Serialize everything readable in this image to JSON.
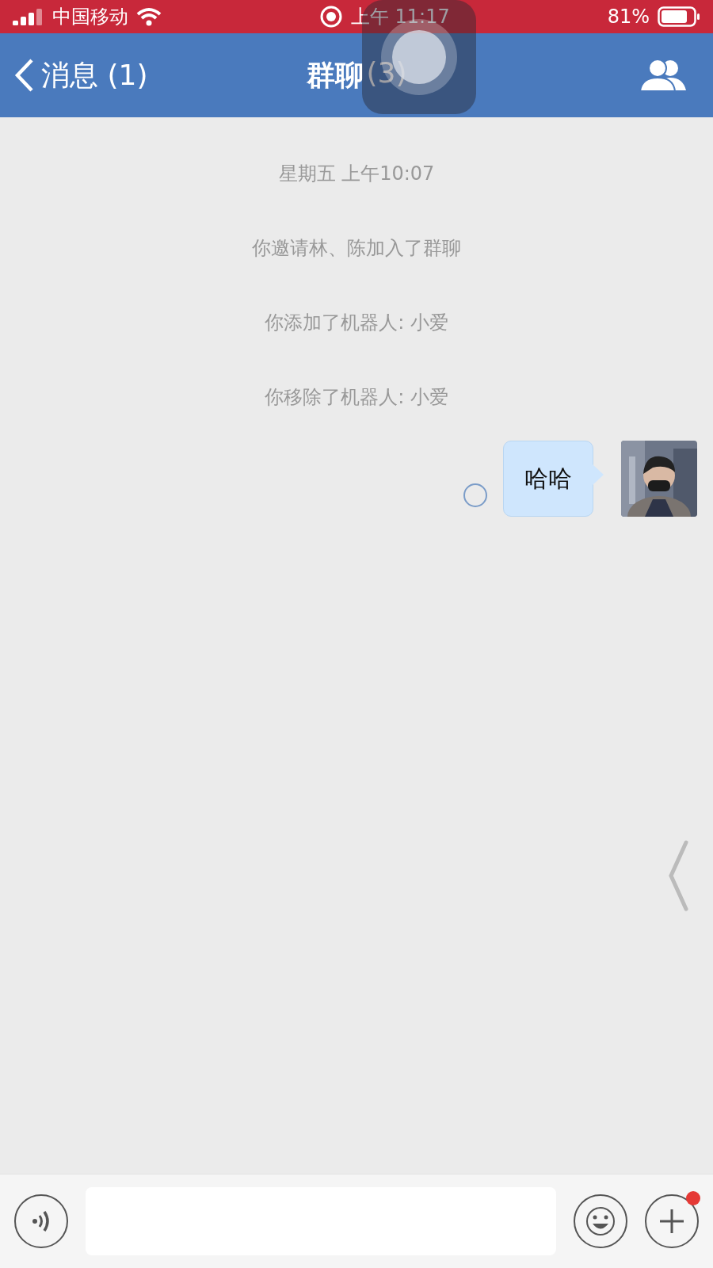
{
  "status_bar": {
    "carrier": "中国移动",
    "time": "上午 11:17",
    "battery": "81%"
  },
  "nav_bar": {
    "back": "消息 (1)",
    "title": "群聊",
    "count": "(3)"
  },
  "messages": [
    {
      "kind": "time",
      "text": "星期五 上午10:07"
    },
    {
      "kind": "system",
      "text": "你邀请林、陈加入了群聊"
    },
    {
      "kind": "system",
      "text": "你添加了机器人: 小爱"
    },
    {
      "kind": "system",
      "text": "你移除了机器人: 小爱"
    },
    {
      "kind": "outgoing",
      "text": "哈哈"
    }
  ],
  "input_bar": {
    "plus_has_notification": true
  }
}
